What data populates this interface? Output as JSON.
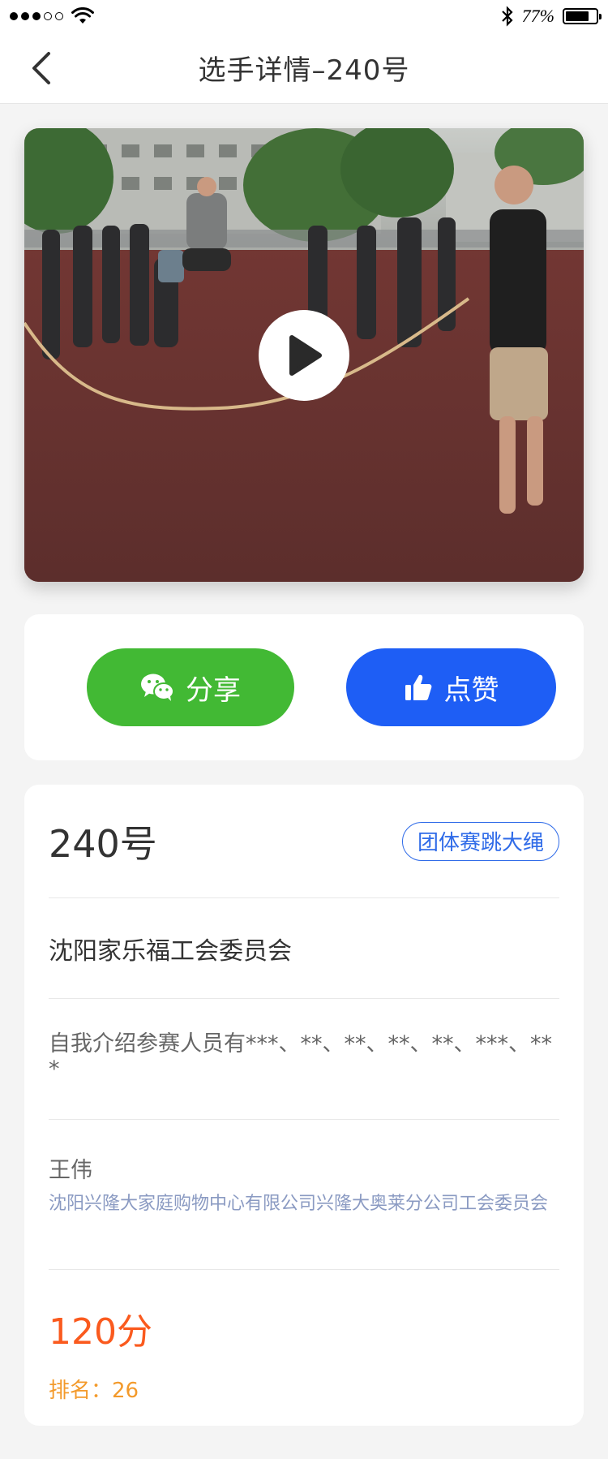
{
  "status_bar": {
    "battery_text": "77%",
    "battery_level": 0.77,
    "signal_bars_filled": 3,
    "signal_bars_total": 5,
    "icons": [
      "signal-dots-icon",
      "wifi-icon",
      "bluetooth-icon",
      "battery-icon"
    ]
  },
  "nav": {
    "title": "选手详情–240号",
    "back_icon": "chevron-left-icon"
  },
  "video": {
    "play_icon": "play-icon"
  },
  "actions": {
    "share_label": "分享",
    "share_icon": "wechat-icon",
    "like_label": "点赞",
    "like_icon": "thumbs-up-icon"
  },
  "detail": {
    "player_number": "240号",
    "category_tag": "团体赛跳大绳",
    "organization": "沈阳家乐福工会委员会",
    "intro": "自我介绍参赛人员有***、**、**、**、**、***、***",
    "contact_name": "王伟",
    "contact_company": "沈阳兴隆大家庭购物中心有限公司兴隆大奥莱分公司工会委员会",
    "score": "120分",
    "rank_label": "排名：",
    "rank_value": "26"
  },
  "colors": {
    "share_green": "#42b934",
    "like_blue": "#1e5ef5",
    "tag_blue": "#2f6be8",
    "score_orange": "#fa5a1e",
    "rank_orange": "#f39a2b",
    "company_gray_blue": "#8a9ac2"
  }
}
